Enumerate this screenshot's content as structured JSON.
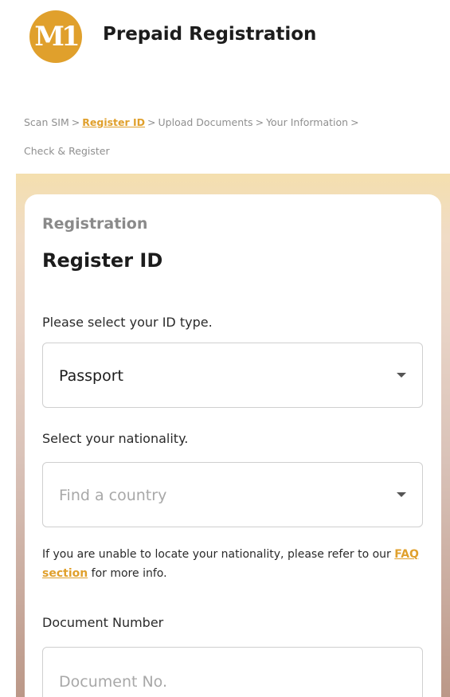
{
  "header": {
    "logo_text": "M1",
    "title": "Prepaid Registration"
  },
  "breadcrumb": {
    "steps": [
      "Scan SIM",
      "Register ID",
      "Upload Documents",
      "Your Information",
      "Check & Register"
    ],
    "separator": ">",
    "active_index": 1
  },
  "card": {
    "subtitle": "Registration",
    "title": "Register ID"
  },
  "form": {
    "id_type_label": "Please select your ID type.",
    "id_type_value": "Passport",
    "nationality_label": "Select your nationality.",
    "nationality_placeholder": "Find a country",
    "info_prefix": "If you are unable to locate your nationality, please refer to our",
    "faq_link": "FAQ section",
    "info_suffix": "for more info.",
    "document_label": "Document Number",
    "document_placeholder": "Document No."
  },
  "colors": {
    "accent": "#e0a02c"
  }
}
